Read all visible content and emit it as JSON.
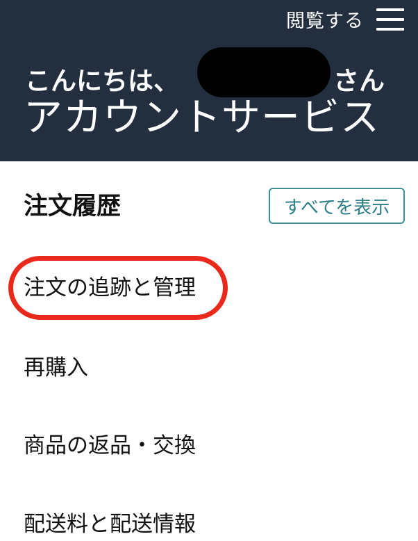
{
  "header": {
    "browse_label": "閲覧する",
    "menu_icon": "hamburger-icon",
    "greeting_prefix": "こんにちは、",
    "greeting_suffix": "さん",
    "title": "アカウントサービス",
    "background_color": "#232f3e"
  },
  "orders": {
    "section_title": "注文履歴",
    "show_all_label": "すべてを表示",
    "items": [
      {
        "label": "注文の追跡と管理",
        "highlighted": true
      },
      {
        "label": "再購入",
        "highlighted": false
      },
      {
        "label": "商品の返品・交換",
        "highlighted": false
      },
      {
        "label": "配送料と配送情報",
        "highlighted": false
      }
    ]
  },
  "colors": {
    "accent_teal": "#3b8e92",
    "highlight_red": "#e8291c"
  }
}
